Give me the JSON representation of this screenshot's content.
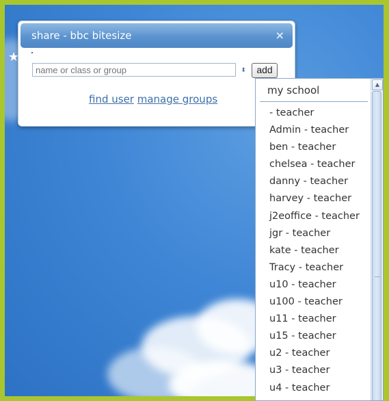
{
  "dialog": {
    "title": "share - bbc bitesize",
    "close_glyph": "×",
    "input_placeholder": "name or class or group",
    "add_label": "add",
    "find_user_link": "find user",
    "manage_groups_link": "manage groups"
  },
  "dropdown": {
    "header": "my school",
    "items": [
      " - teacher",
      "Admin - teacher",
      "ben - teacher",
      "chelsea - teacher",
      "danny - teacher",
      "harvey - teacher",
      "j2eoffice - teacher",
      "jgr - teacher",
      "kate - teacher",
      "Tracy - teacher",
      "u10 - teacher",
      "u100 - teacher",
      "u11 - teacher",
      "u15 - teacher",
      "u2 - teacher",
      "u3 - teacher",
      "u4 - teacher"
    ]
  },
  "colors": {
    "frame_border": "#a9c62f",
    "sky": "#3f86d6",
    "titlebar": "#5b93cf",
    "link": "#3d6fa8"
  }
}
